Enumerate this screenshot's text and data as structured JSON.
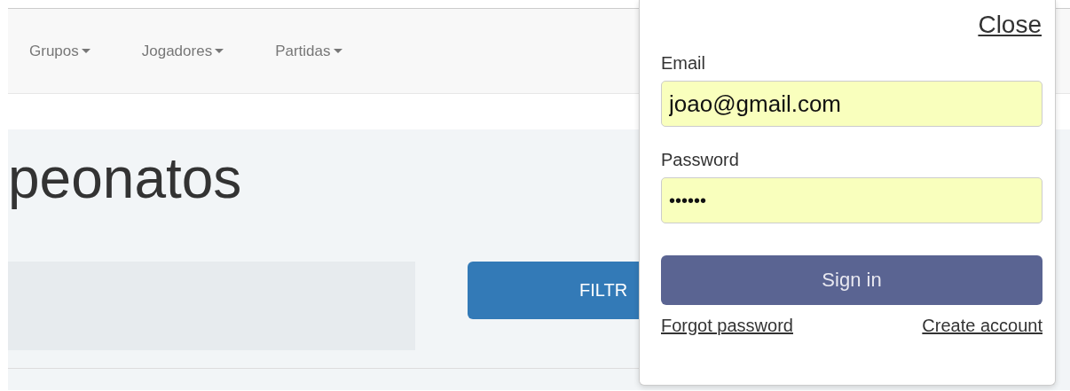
{
  "navbar": {
    "items": [
      {
        "label": "Grupos"
      },
      {
        "label": "Jogadores"
      },
      {
        "label": "Partidas"
      }
    ]
  },
  "page": {
    "heading": "peonatos",
    "filter_button": "FILTR"
  },
  "login": {
    "close": "Close",
    "email_label": "Email",
    "email_value": "joao@gmail.com",
    "password_label": "Password",
    "password_value": "••••••",
    "submit": "Sign in",
    "forgot": "Forgot password",
    "create": "Create account"
  }
}
